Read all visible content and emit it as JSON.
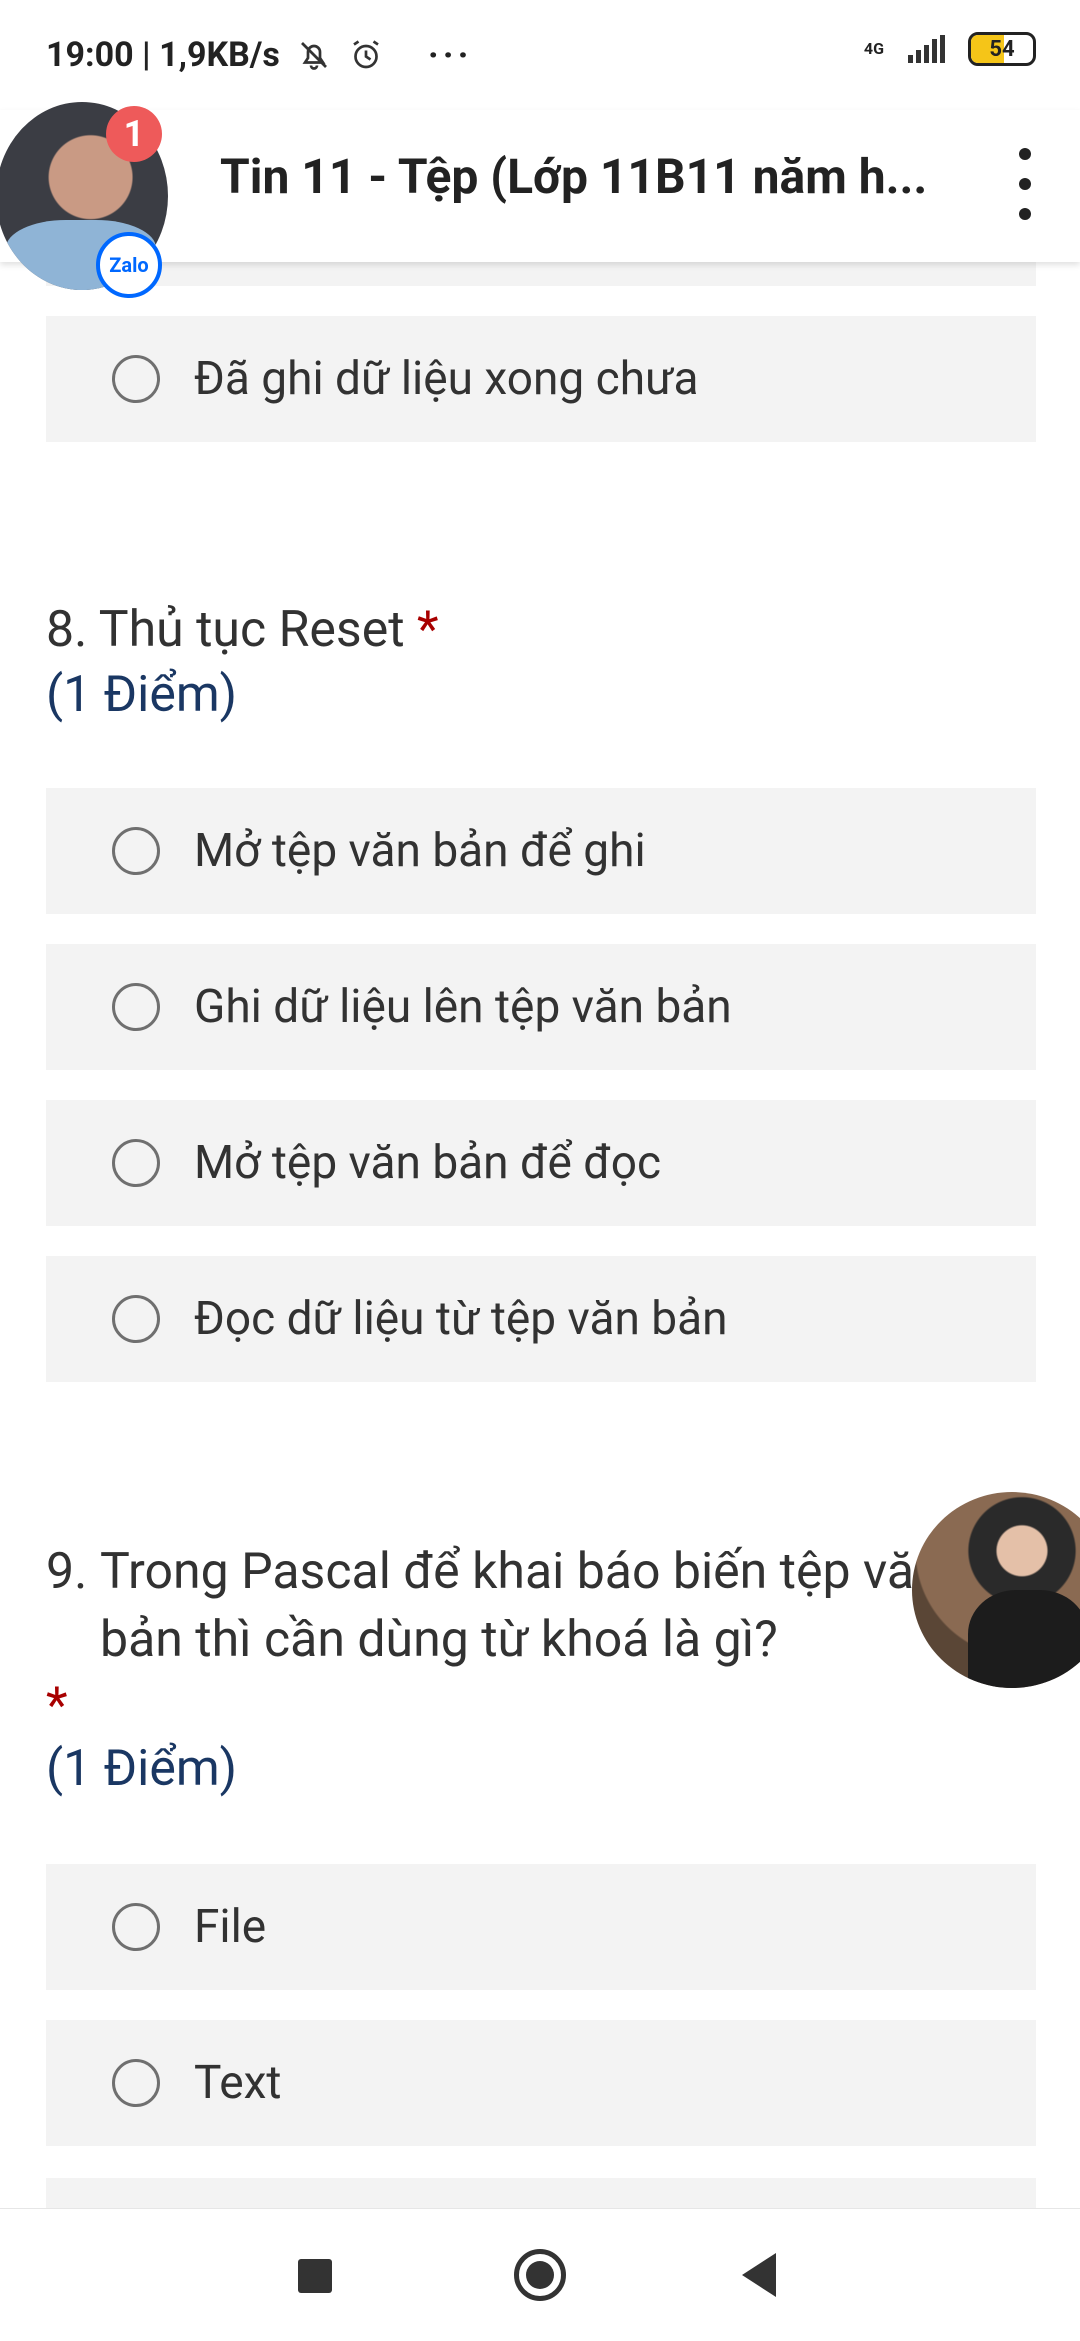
{
  "status_bar": {
    "time_speed": "19:00 | 1,9KB/s",
    "more": "···",
    "network": "4G",
    "battery": "54",
    "battery_level": 0.54
  },
  "app_bar": {
    "title": "Tin 11 - Tệp (Lớp 11B11 năm h..."
  },
  "chat_bubble": {
    "badge_count": "1",
    "app_label": "Zalo"
  },
  "questions": [
    {
      "options": [
        "Đã ghi dữ liệu xong chưa"
      ]
    },
    {
      "number": "8.",
      "text": "Thủ tục Reset",
      "required": "*",
      "points": "(1 Điểm)",
      "options": [
        "Mở tệp văn bản để ghi",
        "Ghi dữ liệu lên tệp văn bản",
        "Mở tệp văn bản để đọc",
        "Đọc dữ liệu từ tệp văn bản"
      ]
    },
    {
      "number": "9.",
      "text": "Trong Pascal để khai báo biến tệp văn bản thì cần dùng từ khoá là gì?",
      "required": "*",
      "points": "(1 Điểm)",
      "options": [
        "File",
        "Text"
      ]
    }
  ]
}
